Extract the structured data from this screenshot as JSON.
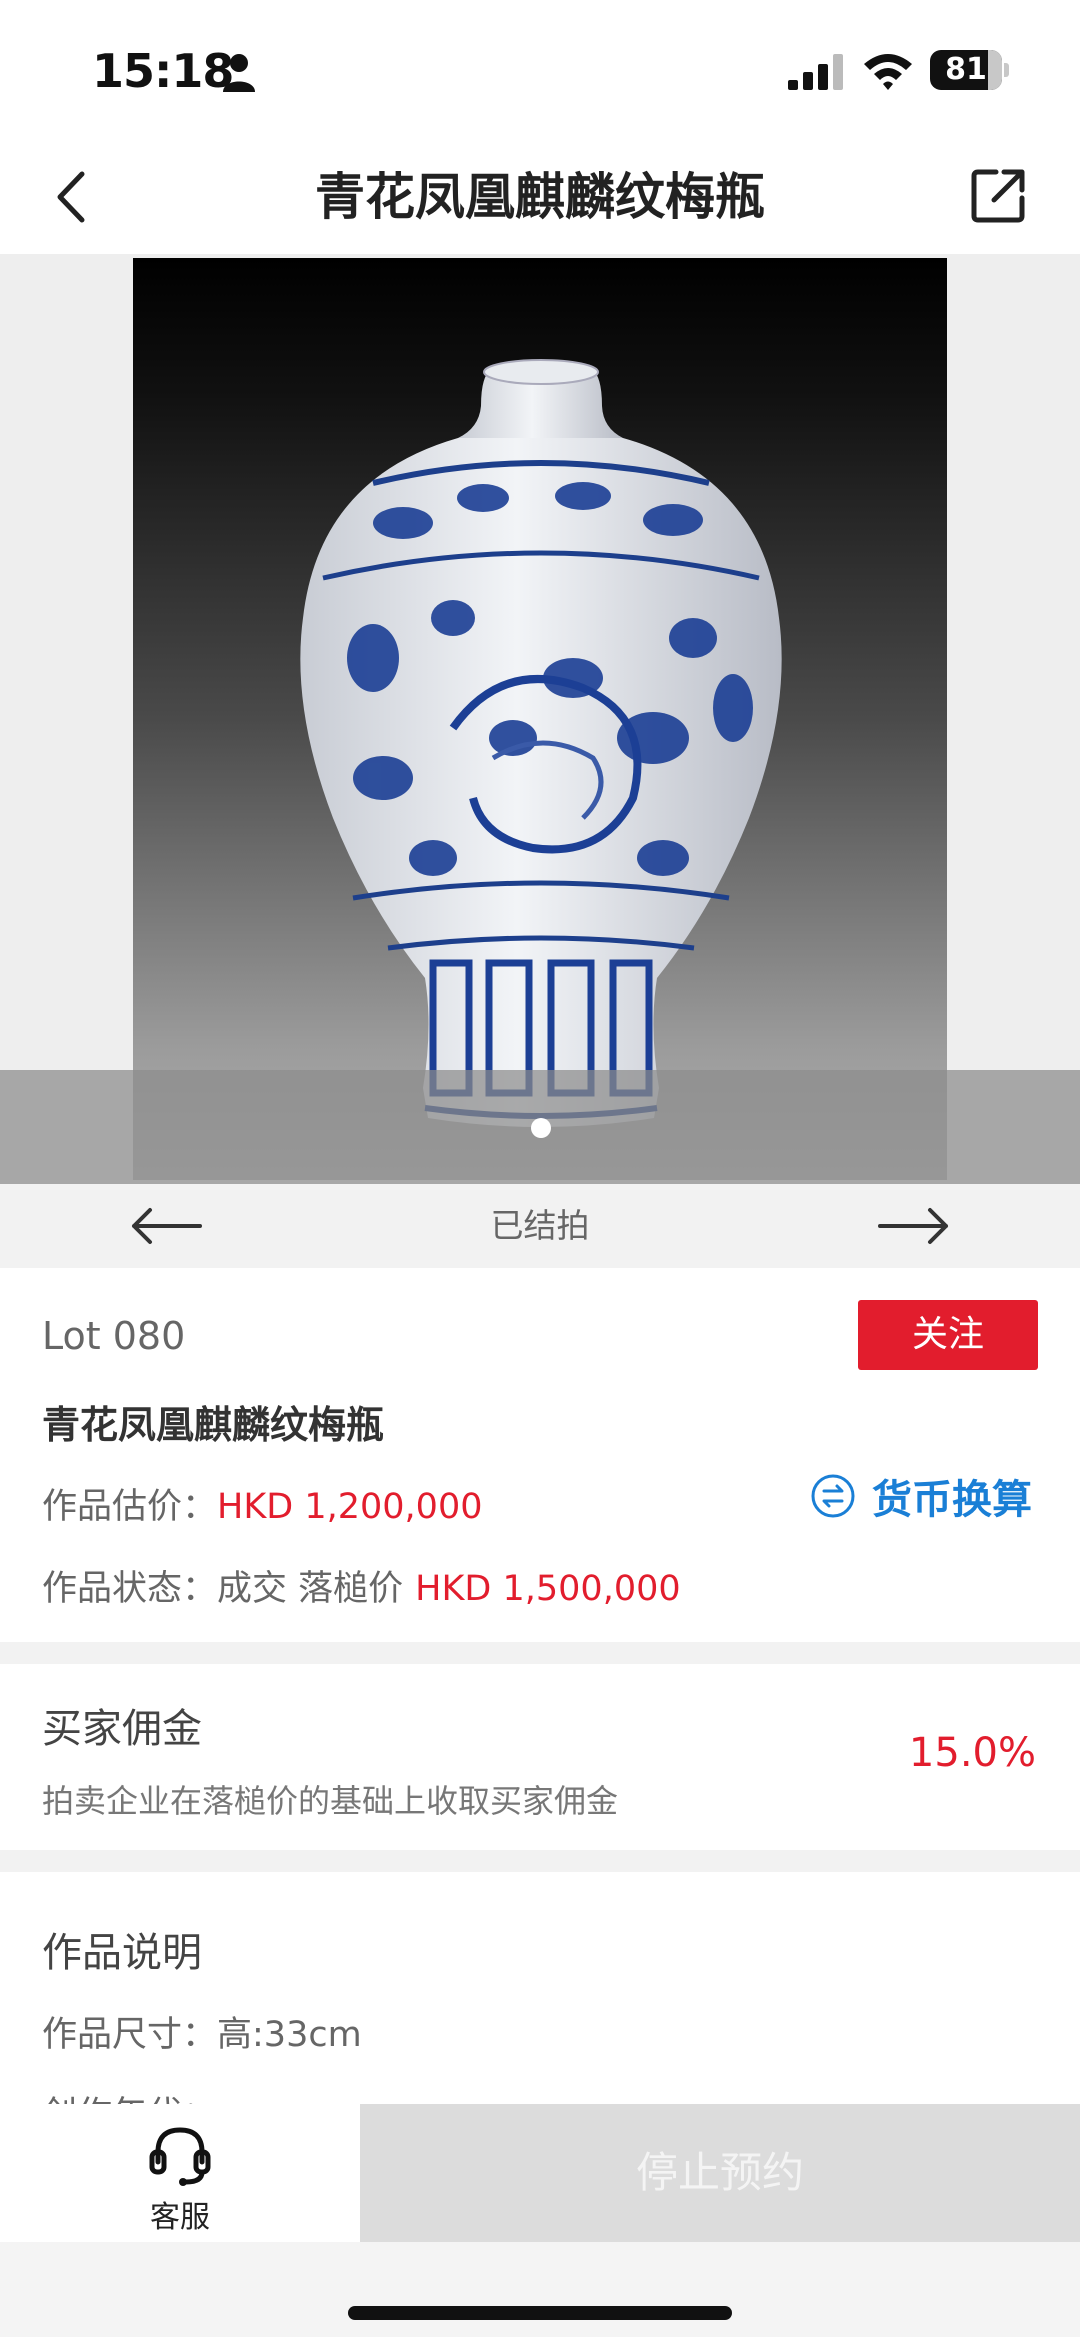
{
  "status_bar": {
    "time": "15:18",
    "battery": "81",
    "battery_level": 0.81
  },
  "nav": {
    "title": "青花凤凰麒麟纹梅瓶"
  },
  "gallery": {
    "image_count": 1,
    "current_index": 1
  },
  "pager": {
    "status": "已结拍"
  },
  "lot": {
    "number": "Lot 080",
    "follow_label": "关注",
    "title": "青花凤凰麒麟纹梅瓶",
    "estimate_label": "作品估价：",
    "estimate_value": "HKD 1,200,000",
    "currency_label": "货币换算",
    "status_label": "作品状态：",
    "status_value": "成交 落槌价",
    "hammer_price": "HKD 1,500,000"
  },
  "commission": {
    "title": "买家佣金",
    "description": "拍卖企业在落槌价的基础上收取买家佣金",
    "rate": "15.0%"
  },
  "description": {
    "title": "作品说明",
    "size_label": "作品尺寸：",
    "size_value": "高:33cm",
    "year_label": "创作年代："
  },
  "bottom": {
    "service_label": "客服",
    "stop_label": "停止预约"
  },
  "colors": {
    "accent_red": "#e21d2d",
    "link_blue": "#1a7fd6"
  }
}
